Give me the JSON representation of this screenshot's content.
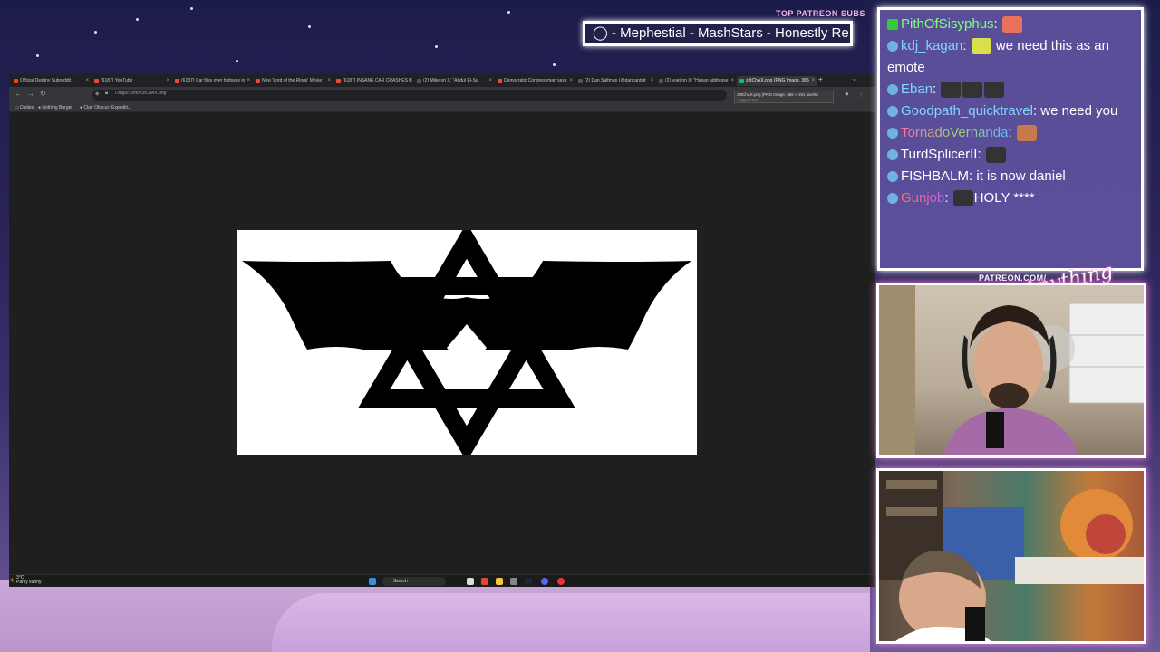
{
  "overlay": {
    "patreon_header": "TOP PATREON SUBS",
    "ticker_text": "- Mephestial - MashStars - Honestly Re",
    "patreon_url": "PATREON.COM/",
    "logo_text": "Anything Else?"
  },
  "browser": {
    "tabs": [
      {
        "label": "Official Destiny Subreddit",
        "fav_color": "#ff4500"
      },
      {
        "label": "(6187) YouTube",
        "fav_color": "#ff0000"
      },
      {
        "label": "(6187) Car flies over highway in",
        "fav_color": "#ff0000"
      },
      {
        "label": "New 'Lord of the Rings' Movie I",
        "fav_color": "#e74c3c"
      },
      {
        "label": "(6187) INSANE CAR CRASHES C",
        "fav_color": "#ff0000"
      },
      {
        "label": "(2) Mike on X: \"Abdul El-Sa",
        "fav_color": "#000000"
      },
      {
        "label": "Democratic Congressman says",
        "fav_color": "#e74c3c"
      },
      {
        "label": "(2) Dan Saltman (@dancantstr",
        "fav_color": "#000000"
      },
      {
        "label": "(2) yoet on X: \"Hasan addresse",
        "fav_color": "#000000"
      },
      {
        "label": "z3tChAX.png (PNG Image, 386",
        "fav_color": "#1bb76e"
      }
    ],
    "url": "i.imgur.com/z3tChAX.png",
    "tooltip_title": "z3tChAX.png (PNG Image, 386 × 191 pixels)",
    "tooltip_sub": "i.imgur.com",
    "bookmarks": [
      "Dailies",
      "Nothing Burger",
      "Clair Obscur: Expediti..."
    ]
  },
  "taskbar": {
    "temperature": "3°C",
    "condition": "Partly sunny",
    "search_label": "Search"
  },
  "chat": {
    "messages": [
      {
        "user": "PithOfSisyphus",
        "color": "#7fff7f",
        "text": ""
      },
      {
        "user": "kdj_kagan",
        "color": "#7fd7ff",
        "text": "we need this as an emote"
      },
      {
        "user": "Eban",
        "color": "#7fd7ff",
        "text": ""
      },
      {
        "user": "Goodpath_quicktravel",
        "color": "#7fd7ff",
        "text": "we need you"
      },
      {
        "user": "TornadoVernanda",
        "color": "#ff9b4a",
        "text": ""
      },
      {
        "user": "TurdSplicerII",
        "color": "#ffffff",
        "text": ""
      },
      {
        "user": "FISHBALM",
        "color": "#ffffff",
        "text": "it is now daniel"
      },
      {
        "user": "Gunjob",
        "color": "#ff7a3a",
        "text": "HOLY ****"
      }
    ]
  }
}
